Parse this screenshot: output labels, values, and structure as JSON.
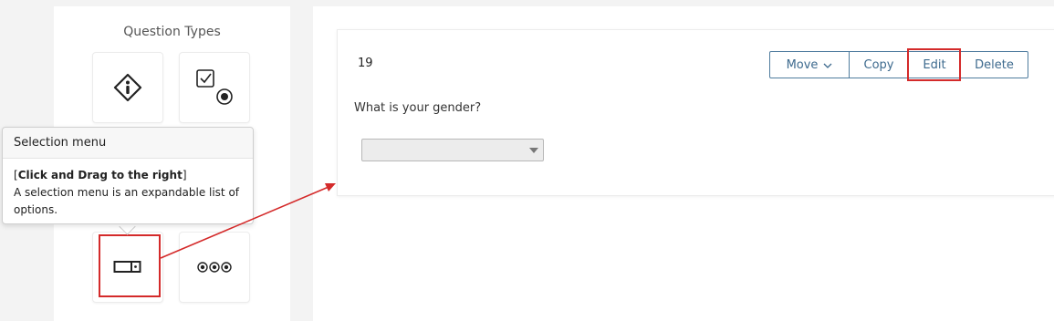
{
  "question_types_panel": {
    "title": "Question Types",
    "tiles": [
      {
        "icon": "info-diamond-icon"
      },
      {
        "icon": "checkbox-radio-icon"
      },
      {
        "icon": "selection-menu-icon"
      },
      {
        "icon": "radio-row-icon"
      }
    ]
  },
  "tooltip": {
    "title": "Selection menu",
    "instruction_prefix": "[",
    "instruction": "Click and Drag to the right",
    "instruction_suffix": "]",
    "description": "A selection menu is an expandable list of options."
  },
  "question": {
    "number": "19",
    "text": "What is your gender?",
    "select_value": ""
  },
  "toolbar": {
    "move_label": "Move",
    "copy_label": "Copy",
    "edit_label": "Edit",
    "delete_label": "Delete"
  },
  "colors": {
    "highlight": "#d42a2a",
    "button_border": "#4f7c9e",
    "button_text": "#3d6a8e"
  }
}
